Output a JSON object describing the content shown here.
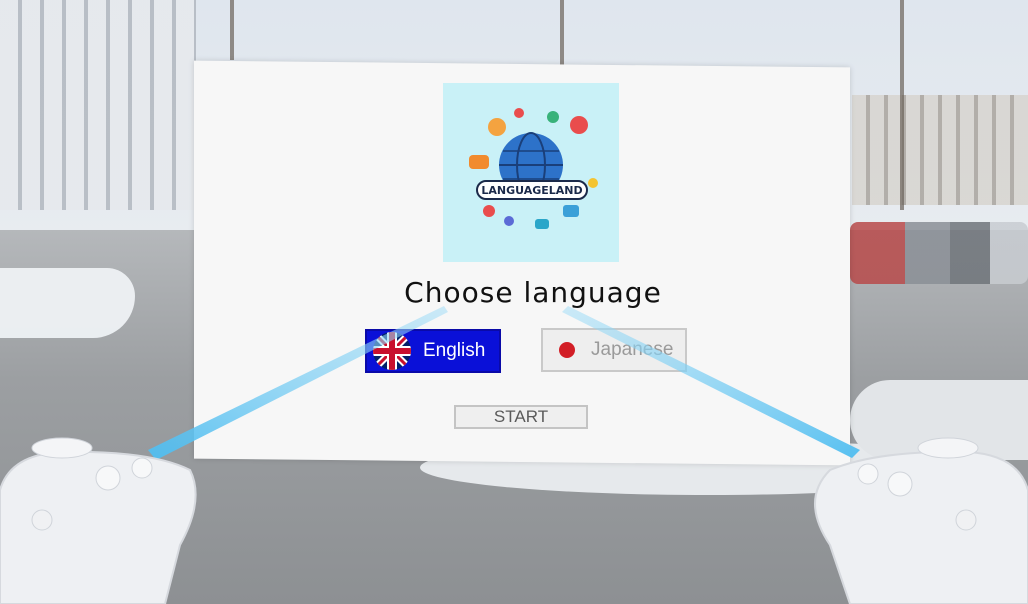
{
  "app": {
    "logo_text": "LANGUAGELAND"
  },
  "panel": {
    "title": "Choose language",
    "languages": [
      {
        "label": "English",
        "selected": true,
        "icon": "uk-flag-icon"
      },
      {
        "label": "Japanese",
        "selected": false,
        "icon": "japan-flag-icon"
      }
    ],
    "start_label": "START"
  },
  "controllers": {
    "left": {
      "icon": "vr-controller-left-icon",
      "ray": true
    },
    "right": {
      "icon": "vr-controller-right-icon",
      "ray": true
    }
  },
  "colors": {
    "selected_button": "#0a10d8",
    "unselected_button": "#eeeeee",
    "ray": "#5cc8f2",
    "panel": "#f7f7f7",
    "logo_bg": "#c9f1f7"
  }
}
